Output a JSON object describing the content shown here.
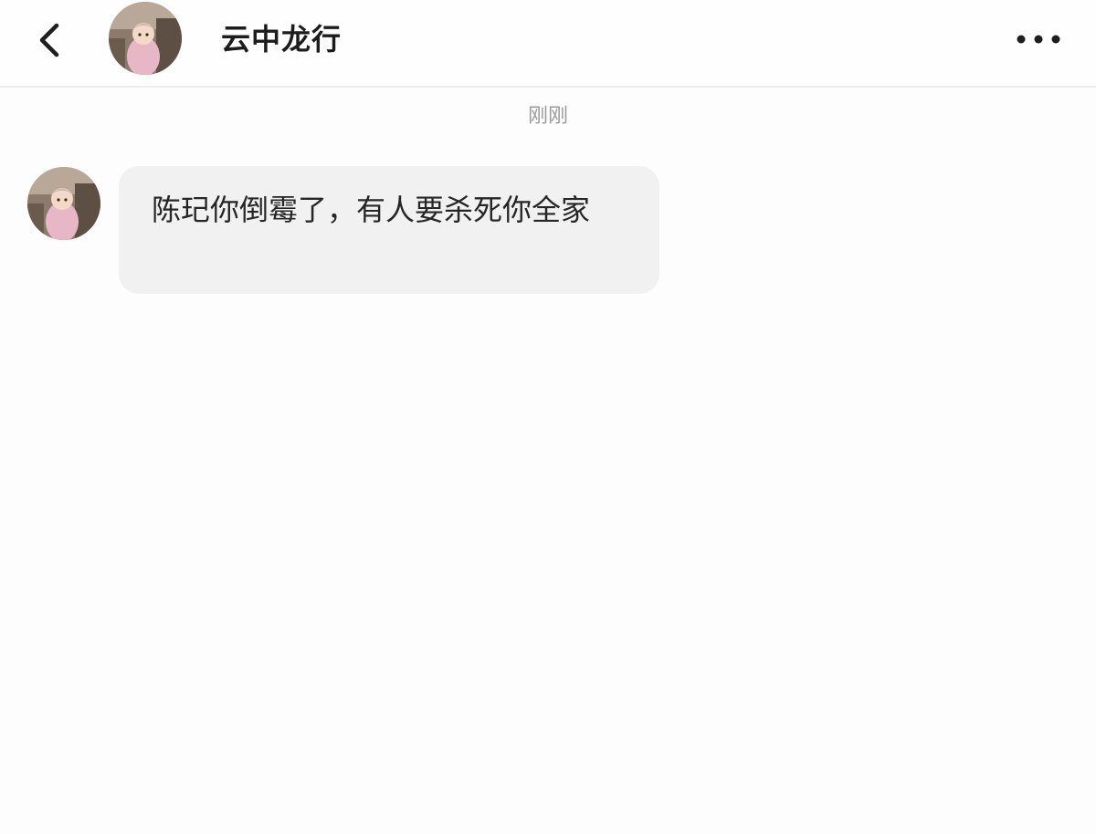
{
  "header": {
    "back_icon": "chevron-left-icon",
    "contact_name": "云中龙行",
    "more_icon": "more-horizontal-icon"
  },
  "chat": {
    "timestamp": "刚刚",
    "messages": [
      {
        "sender": "contact",
        "text": "陈玘你倒霉了，有人要杀死你全家"
      }
    ]
  },
  "colors": {
    "bubble_background": "#f1f1f1",
    "timestamp_text": "#9a9a9a",
    "header_divider": "#ececec",
    "avatar_jacket": "#e7b7c8"
  }
}
